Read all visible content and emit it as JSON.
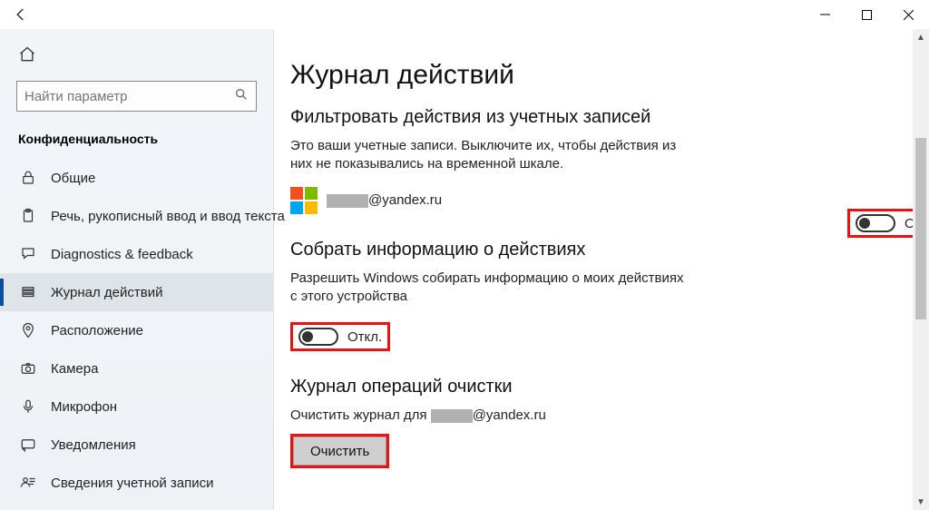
{
  "window": {
    "back_tooltip": "Назад"
  },
  "sidebar": {
    "search_placeholder": "Найти параметр",
    "section_title": "Конфиденциальность",
    "items": [
      {
        "icon": "lock",
        "label": "Общие"
      },
      {
        "icon": "clipboard",
        "label": "Речь, рукописный ввод и ввод текста"
      },
      {
        "icon": "feedback",
        "label": "Diagnostics & feedback"
      },
      {
        "icon": "activity",
        "label": "Журнал действий"
      },
      {
        "icon": "location",
        "label": "Расположение"
      },
      {
        "icon": "camera",
        "label": "Камера"
      },
      {
        "icon": "mic",
        "label": "Микрофон"
      },
      {
        "icon": "notify",
        "label": "Уведомления"
      },
      {
        "icon": "account",
        "label": "Сведения учетной записи"
      }
    ],
    "selected_index": 3
  },
  "main": {
    "title": "Журнал действий",
    "filter": {
      "heading": "Фильтровать действия из учетных записей",
      "desc": "Это ваши учетные записи. Выключите их, чтобы действия из них не показывались на временной шкале.",
      "account_email_suffix": "@yandex.ru",
      "toggle_label": "Откл."
    },
    "collect": {
      "heading": "Собрать информацию о действиях",
      "desc": "Разрешить Windows собирать информацию о моих действиях с этого устройства",
      "toggle_label": "Откл."
    },
    "clear": {
      "heading": "Журнал операций очистки",
      "desc_prefix": "Очистить журнал для ",
      "desc_suffix": "@yandex.ru",
      "button_label": "Очистить"
    }
  }
}
